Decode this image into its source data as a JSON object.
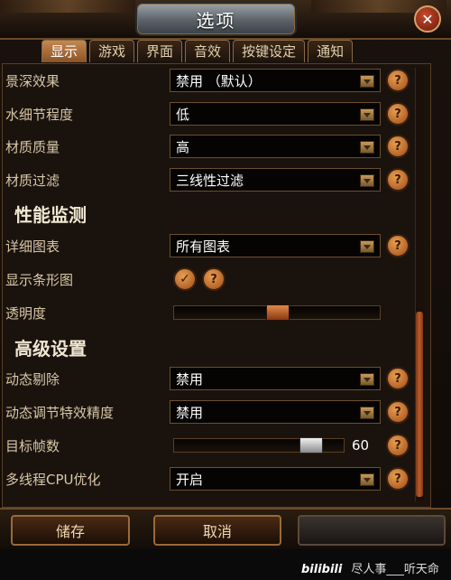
{
  "window": {
    "title": "选项",
    "close_glyph": "✕"
  },
  "tabs": [
    {
      "label": "显示",
      "active": true
    },
    {
      "label": "游戏",
      "active": false
    },
    {
      "label": "界面",
      "active": false
    },
    {
      "label": "音效",
      "active": false
    },
    {
      "label": "按键设定",
      "active": false
    },
    {
      "label": "通知",
      "active": false
    }
  ],
  "settings": {
    "depth_of_field": {
      "label": "景深效果",
      "value": "禁用 （默认）"
    },
    "water_detail": {
      "label": "水细节程度",
      "value": "低"
    },
    "texture_quality": {
      "label": "材质质量",
      "value": "高"
    },
    "texture_filter": {
      "label": "材质过滤",
      "value": "三线性过滤"
    },
    "perf_section": "性能监测",
    "detail_chart": {
      "label": "详细图表",
      "value": "所有图表"
    },
    "show_bar": {
      "label": "显示条形图",
      "checked": true
    },
    "opacity": {
      "label": "透明度",
      "level": 0.5
    },
    "adv_section": "高级设置",
    "dynamic_cull": {
      "label": "动态剔除",
      "value": "禁用"
    },
    "dynamic_fx": {
      "label": "动态调节特效精度",
      "value": "禁用"
    },
    "target_fps": {
      "label": "目标帧数",
      "value": "60",
      "level": 0.85
    },
    "multithread_cpu": {
      "label": "多线程CPU优化",
      "value": "开启"
    }
  },
  "help_glyph": "?",
  "check_glyph": "✓",
  "buttons": {
    "save": "储存",
    "cancel": "取消"
  },
  "watermark": {
    "logo": "bilibili",
    "text": "尽人事___听天命"
  },
  "colors": {
    "accent": "#c48850",
    "help": "#e8a050",
    "slider_knob": "#e08a4a"
  }
}
